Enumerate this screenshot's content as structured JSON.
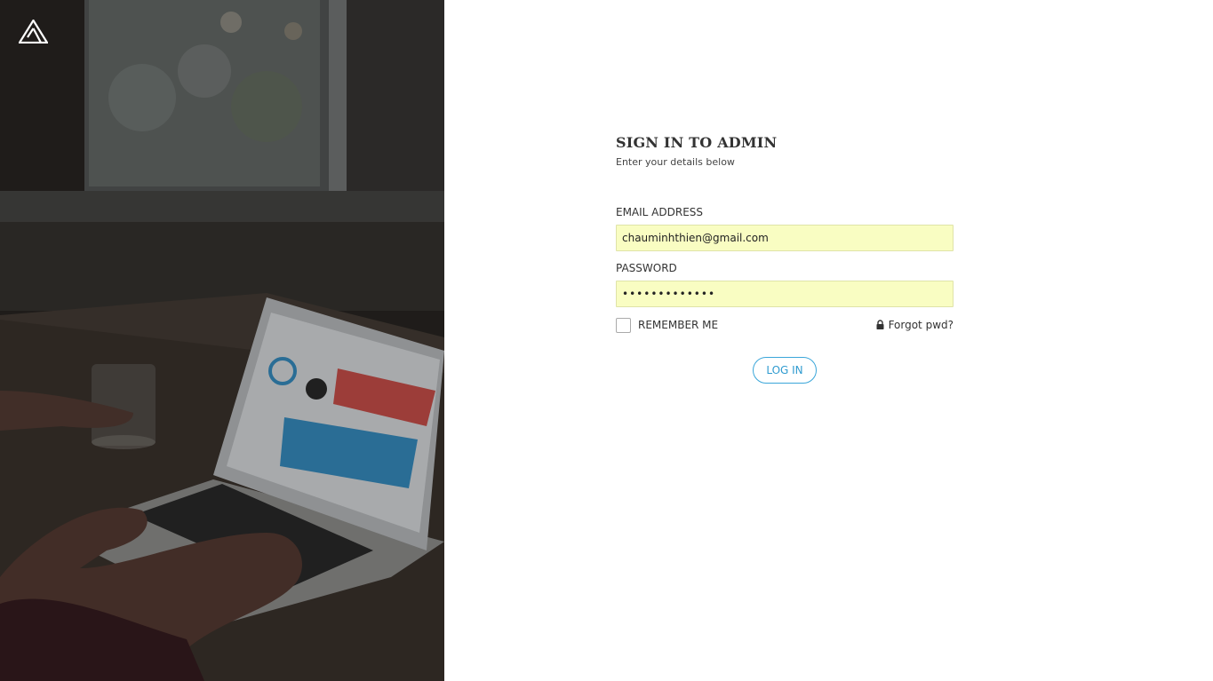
{
  "brand": {
    "logo_icon": "triangle-logo-icon"
  },
  "photo": {
    "icon": "laptop-photo"
  },
  "form": {
    "title": "SIGN IN TO ADMIN",
    "subtitle": "Enter your details below",
    "email_label": "EMAIL ADDRESS",
    "email_value": "chauminhthien@gmail.com",
    "password_label": "PASSWORD",
    "password_value": "•••••••••••••",
    "remember_label": "REMEMBER ME",
    "remember_checked": false,
    "forgot_label": "Forgot pwd?",
    "forgot_icon": "lock-icon",
    "login_label": "LOG IN"
  },
  "colors": {
    "input_bg": "#f9fdc2",
    "button_accent": "#2f9bd0",
    "photo_dark": "#2d2a27"
  }
}
